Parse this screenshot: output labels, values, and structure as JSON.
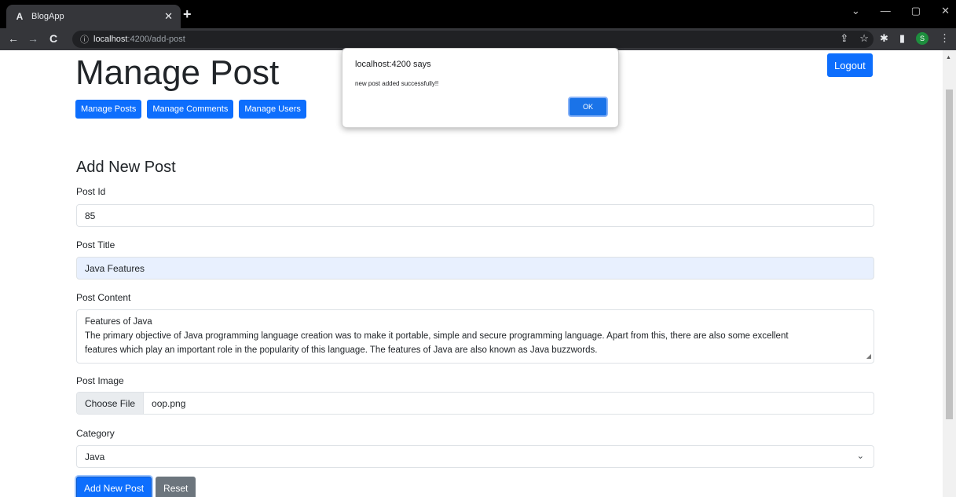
{
  "browser": {
    "tab_title": "BlogApp",
    "tab_favicon": "A",
    "close_glyph": "✕",
    "newtab_glyph": "+",
    "url_host": "localhost",
    "url_rest": ":4200/add-post",
    "back_glyph": "←",
    "forward_glyph": "→",
    "reload_glyph": "C",
    "info_glyph": "ⓘ",
    "share_glyph": "⇪",
    "star_glyph": "☆",
    "ext_glyph": "✱",
    "panel_glyph": "▮",
    "profile_initial": "S",
    "menu_glyph": "⋮",
    "win_chevron": "⌄",
    "win_min": "—",
    "win_max": "▢",
    "win_close": "✕",
    "scroll_up": "▲"
  },
  "header": {
    "title": "Manage Post",
    "logout_label": "Logout",
    "nav": [
      "Manage Posts",
      "Manage Comments",
      "Manage Users"
    ]
  },
  "form": {
    "title": "Add New Post",
    "post_id_label": "Post Id",
    "post_id_value": "85",
    "post_title_label": "Post Title",
    "post_title_value": "Java Features",
    "post_content_label": "Post Content",
    "post_content_lines": [
      "Features of Java",
      "The primary objective of Java programming language creation was to make it portable, simple and secure programming language. Apart from this, there are also some excellent",
      "features which play an important role in the popularity of this language. The features of Java are also known as Java buzzwords."
    ],
    "post_image_label": "Post Image",
    "choose_file_label": "Choose File",
    "file_name": "oop.png",
    "category_label": "Category",
    "category_value": "Java",
    "chevron_glyph": "⌄",
    "resize_glyph": "◢",
    "submit_label": "Add New Post",
    "reset_label": "Reset"
  },
  "alert": {
    "title": "localhost:4200 says",
    "message": "new post added successfully!!",
    "ok_label": "OK"
  },
  "colors": {
    "primary": "#0d6efd",
    "secondary": "#6c757d",
    "chrome_dark": "#35363a",
    "autofill": "#e8f0fe"
  }
}
